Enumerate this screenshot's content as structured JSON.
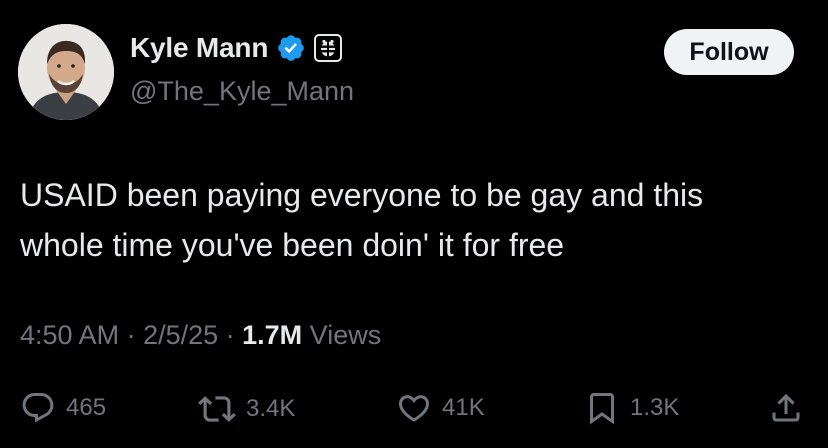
{
  "author": {
    "display_name": "Kyle Mann",
    "handle": "@The_Kyle_Mann",
    "avatar_icon": "profile-photo",
    "verified_icon": "verified-badge-icon",
    "affiliation_icon": "babylon-bee-affiliate-icon"
  },
  "follow": {
    "label": "Follow"
  },
  "tweet": {
    "text": "USAID been paying everyone to be gay and this\nwhole time you've been doin' it for free"
  },
  "meta": {
    "time": "4:50 AM",
    "sep1": " · ",
    "date": "2/5/25",
    "sep2": " · ",
    "views": "1.7M",
    "views_label": " Views"
  },
  "actions": {
    "replies": "465",
    "reposts": "3.4K",
    "likes": "41K",
    "bookmarks": "1.3K"
  },
  "colors": {
    "background": "#000000",
    "text": "#e7e9ea",
    "secondary": "#71767b",
    "verified": "#1d9bf0",
    "button_bg": "#eff3f4"
  }
}
